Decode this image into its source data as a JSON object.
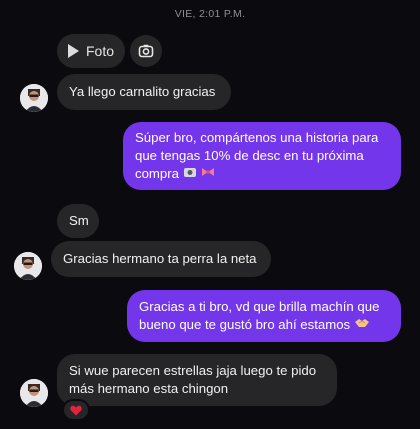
{
  "header": {
    "timestamp": "VIE, 2:01 P.M."
  },
  "media": {
    "photo_label": "Foto"
  },
  "messages": {
    "m1": "Ya llego carnalito gracias",
    "m2_line1": "Súper bro, compártenos una historia para",
    "m2_line2": "que tengas 10% de desc en tu próxima",
    "m2_line3": "compra",
    "m3": "Sm",
    "m4": "Gracias hermano ta perra la neta",
    "m5_line1": "Gracias a ti bro, vd que brilla machín que",
    "m5_line2": "bueno que te gustó bro ahí estamos",
    "m6_line1": "Si wue parecen estrellas jaja luego te pido",
    "m6_line2": "más hermano esta chingon"
  },
  "reactions": {
    "last_message": "heart"
  },
  "colors": {
    "outgoing_bubble": "#7436ea",
    "incoming_bubble": "#262628",
    "background": "#0b0b0f"
  }
}
